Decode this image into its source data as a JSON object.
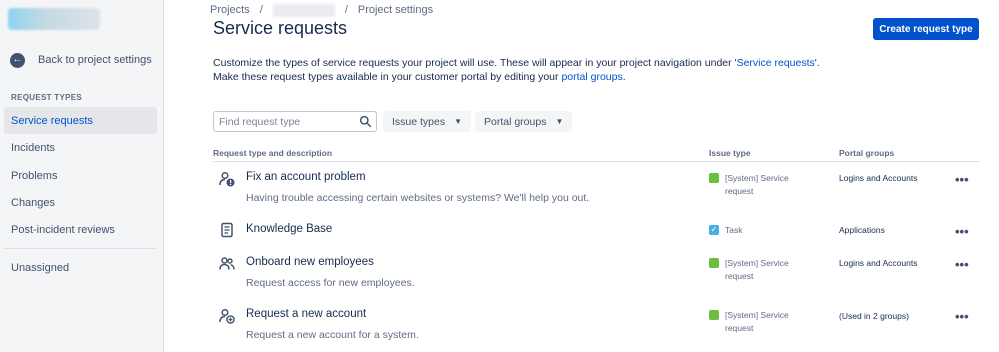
{
  "sidebar": {
    "back_label": "Back to project settings",
    "section_title": "REQUEST TYPES",
    "items": [
      {
        "label": "Service requests",
        "active": true
      },
      {
        "label": "Incidents"
      },
      {
        "label": "Problems"
      },
      {
        "label": "Changes"
      },
      {
        "label": "Post-incident reviews"
      }
    ],
    "unassigned_label": "Unassigned"
  },
  "breadcrumb": {
    "projects": "Projects",
    "current": "Project settings",
    "separator": "/"
  },
  "page": {
    "title": "Service requests",
    "create_button": "Create request type",
    "desc_part1": "Customize the types of service requests your project will use. These will appear in your project navigation under '",
    "desc_link1": "Service requests",
    "desc_part2": "'.",
    "desc_part3": "Make these request types available in your customer portal by editing your ",
    "desc_link2": "portal groups",
    "desc_part4": "."
  },
  "filters": {
    "search_placeholder": "Find request type",
    "issue_types_label": "Issue types",
    "portal_groups_label": "Portal groups"
  },
  "table": {
    "headers": {
      "type": "Request type and description",
      "issue_type": "Issue type",
      "portal_groups": "Portal groups"
    },
    "rows": [
      {
        "icon": "person-alert-icon",
        "title": "Fix an account problem",
        "description": "Having trouble accessing certain websites or systems? We'll help you out.",
        "issue_line1": "[System] Service",
        "issue_line2": "request",
        "issue_color": "#6abf40",
        "portal": "Logins and Accounts"
      },
      {
        "icon": "document-icon",
        "title": "Knowledge Base",
        "description": "",
        "issue_line1": "Task",
        "issue_line2": "",
        "issue_color": "#4bade8",
        "portal": "Applications"
      },
      {
        "icon": "people-icon",
        "title": "Onboard new employees",
        "description": "Request access for new employees.",
        "issue_line1": "[System] Service",
        "issue_line2": "request",
        "issue_color": "#6abf40",
        "portal": "Logins and Accounts"
      },
      {
        "icon": "person-add-icon",
        "title": "Request a new account",
        "description": "Request a new account for a system.",
        "issue_line1": "[System] Service",
        "issue_line2": "request",
        "issue_color": "#6abf40",
        "portal": "(Used in 2 groups)"
      }
    ],
    "more_glyph": "•••"
  },
  "colors": {
    "primary": "#0052cc",
    "sidebar_bg": "#f4f5f7",
    "text": "#172b4d",
    "subtle_text": "#5e6c84"
  }
}
